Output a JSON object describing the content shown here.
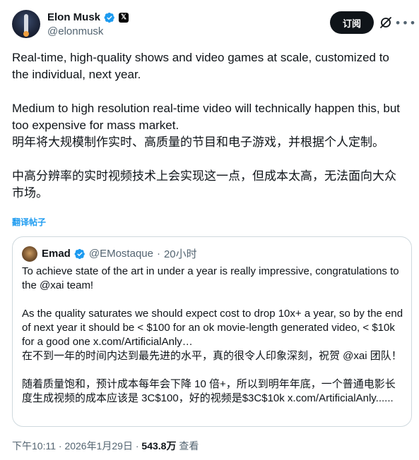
{
  "author": {
    "name": "Elon Musk",
    "handle": "@elonmusk",
    "verified_badge": "blue-check",
    "affiliation_badge": "X"
  },
  "actions": {
    "subscribe_label": "订阅",
    "grok_icon": "grok-icon",
    "more_icon": "more-icon"
  },
  "tweet": {
    "paragraphs": [
      "Real-time, high-quality shows and video games at scale, customized to the individual, next year.",
      "Medium to high resolution real-time video will technically happen this, but too expensive for mass market.",
      "明年将大规模制作实时、高质量的节目和电子游戏，并根据个人定制。",
      "中高分辨率的实时视频技术上会实现这一点，但成本太高，无法面向大众市场。"
    ],
    "translate_link": "翻译帖子"
  },
  "quote": {
    "name": "Emad",
    "handle": "@EMostaque",
    "separator": "·",
    "time": "20小时",
    "paragraphs": [
      "To achieve state of the art in under a year is really impressive, congratulations to the @xai team!",
      "As the quality saturates we should expect cost to drop 10x+ a year, so by the end of next year it should be < $100 for an ok movie-length generated video, < $10k for a good one x.com/ArtificialAnly…",
      "在不到一年的时间内达到最先进的水平，真的很令人印象深刻，祝贺 @xai 团队！",
      "随着质量饱和，预计成本每年会下降 10 倍+，所以到明年年底，一个普通电影长度生成视频的成本应该是 3C$100，好的视频是$3C$10k x.com/ArtificialAnly......"
    ]
  },
  "footer": {
    "time": "下午10:11",
    "date": "2026年1月29日",
    "separator": "·",
    "views_count": "543.8万",
    "views_label": "查看"
  },
  "colors": {
    "accent": "#1d9bf0",
    "text": "#0f1419",
    "secondary": "#536471",
    "border": "#cfd9de"
  }
}
